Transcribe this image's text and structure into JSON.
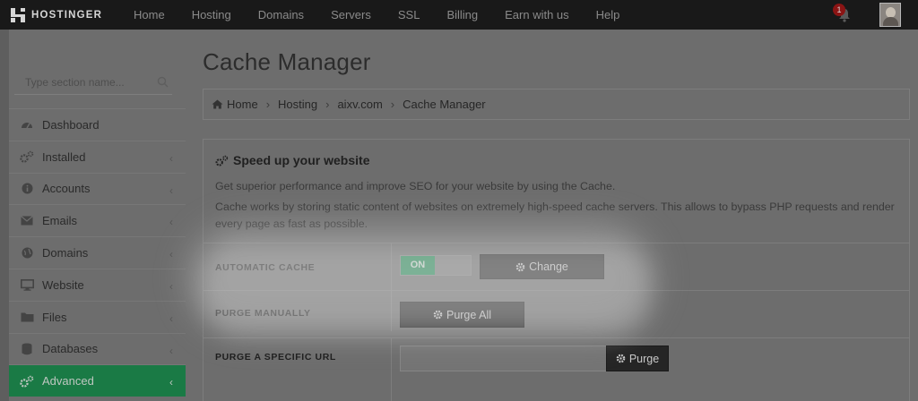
{
  "brand": {
    "name": "HOSTINGER"
  },
  "topnav": {
    "items": [
      {
        "label": "Home"
      },
      {
        "label": "Hosting"
      },
      {
        "label": "Domains"
      },
      {
        "label": "Servers"
      },
      {
        "label": "SSL"
      },
      {
        "label": "Billing"
      },
      {
        "label": "Earn with us"
      },
      {
        "label": "Help"
      }
    ],
    "notifications": {
      "count": "1",
      "icon": "bell-icon"
    },
    "avatar_icon": "user-avatar"
  },
  "sidebar": {
    "search_placeholder": "Type section name...",
    "items": [
      {
        "label": "Dashboard",
        "icon": "dashboard-icon",
        "has_chevron": false
      },
      {
        "label": "Installed",
        "icon": "cogs-icon",
        "has_chevron": true
      },
      {
        "label": "Accounts",
        "icon": "info-icon",
        "has_chevron": true
      },
      {
        "label": "Emails",
        "icon": "envelope-icon",
        "has_chevron": true
      },
      {
        "label": "Domains",
        "icon": "globe-icon",
        "has_chevron": true
      },
      {
        "label": "Website",
        "icon": "monitor-icon",
        "has_chevron": true
      },
      {
        "label": "Files",
        "icon": "folder-icon",
        "has_chevron": true
      },
      {
        "label": "Databases",
        "icon": "database-icon",
        "has_chevron": true
      },
      {
        "label": "Advanced",
        "icon": "cogs-icon",
        "has_chevron": true,
        "active": true
      }
    ]
  },
  "page": {
    "title": "Cache Manager"
  },
  "breadcrumb": {
    "items": [
      {
        "label": "Home"
      },
      {
        "label": "Hosting"
      },
      {
        "label": "aixv.com"
      },
      {
        "label": "Cache Manager"
      }
    ]
  },
  "panel": {
    "title": "Speed up your website",
    "description_1": "Get superior performance and improve SEO for your website by using the Cache.",
    "description_2": "Cache works by storing static content of websites on extremely high-speed cache servers. This allows to bypass PHP requests and render every page as fast as possible.",
    "rows": {
      "automatic_cache": {
        "label": "AUTOMATIC CACHE",
        "toggle_label": "ON",
        "button_label": "Change"
      },
      "purge_manually": {
        "label": "PURGE MANUALLY",
        "button_label": "Purge All"
      },
      "purge_url": {
        "label": "PURGE A SPECIFIC URL",
        "input_value": "",
        "button_label": "Purge"
      }
    }
  },
  "colors": {
    "active_green": "#1a7a45",
    "toggle_green": "#1b8b50",
    "topbar": "#191919",
    "notification_badge": "#8b1414"
  }
}
